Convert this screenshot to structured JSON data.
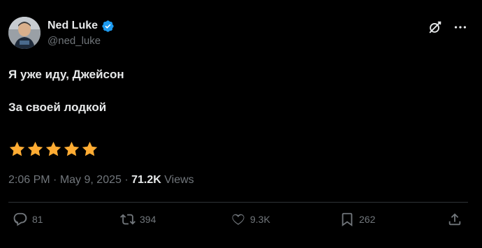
{
  "author": {
    "display_name": "Ned Luke",
    "handle": "@ned_luke",
    "verified_color": "#1d9bf0"
  },
  "tweet": {
    "lines": [
      "Я уже иду, Джейсон",
      "За своей лодкой"
    ],
    "stars": 5,
    "star_color": "#ffac33"
  },
  "meta": {
    "time": "2:06 PM",
    "separator": "·",
    "date": "May 9, 2025",
    "views_count": "71.2K",
    "views_label": "Views"
  },
  "actions": {
    "replies": "81",
    "reposts": "394",
    "likes": "9.3K",
    "bookmarks": "262"
  },
  "icons": {
    "top": [
      "grok-icon",
      "more-icon"
    ],
    "action_bar": [
      "reply-icon",
      "repost-icon",
      "like-icon",
      "bookmark-icon",
      "share-icon"
    ]
  },
  "colors": {
    "background": "#000000",
    "text_primary": "#e7e9ea",
    "text_secondary": "#71767b",
    "divider": "#2f3336"
  }
}
